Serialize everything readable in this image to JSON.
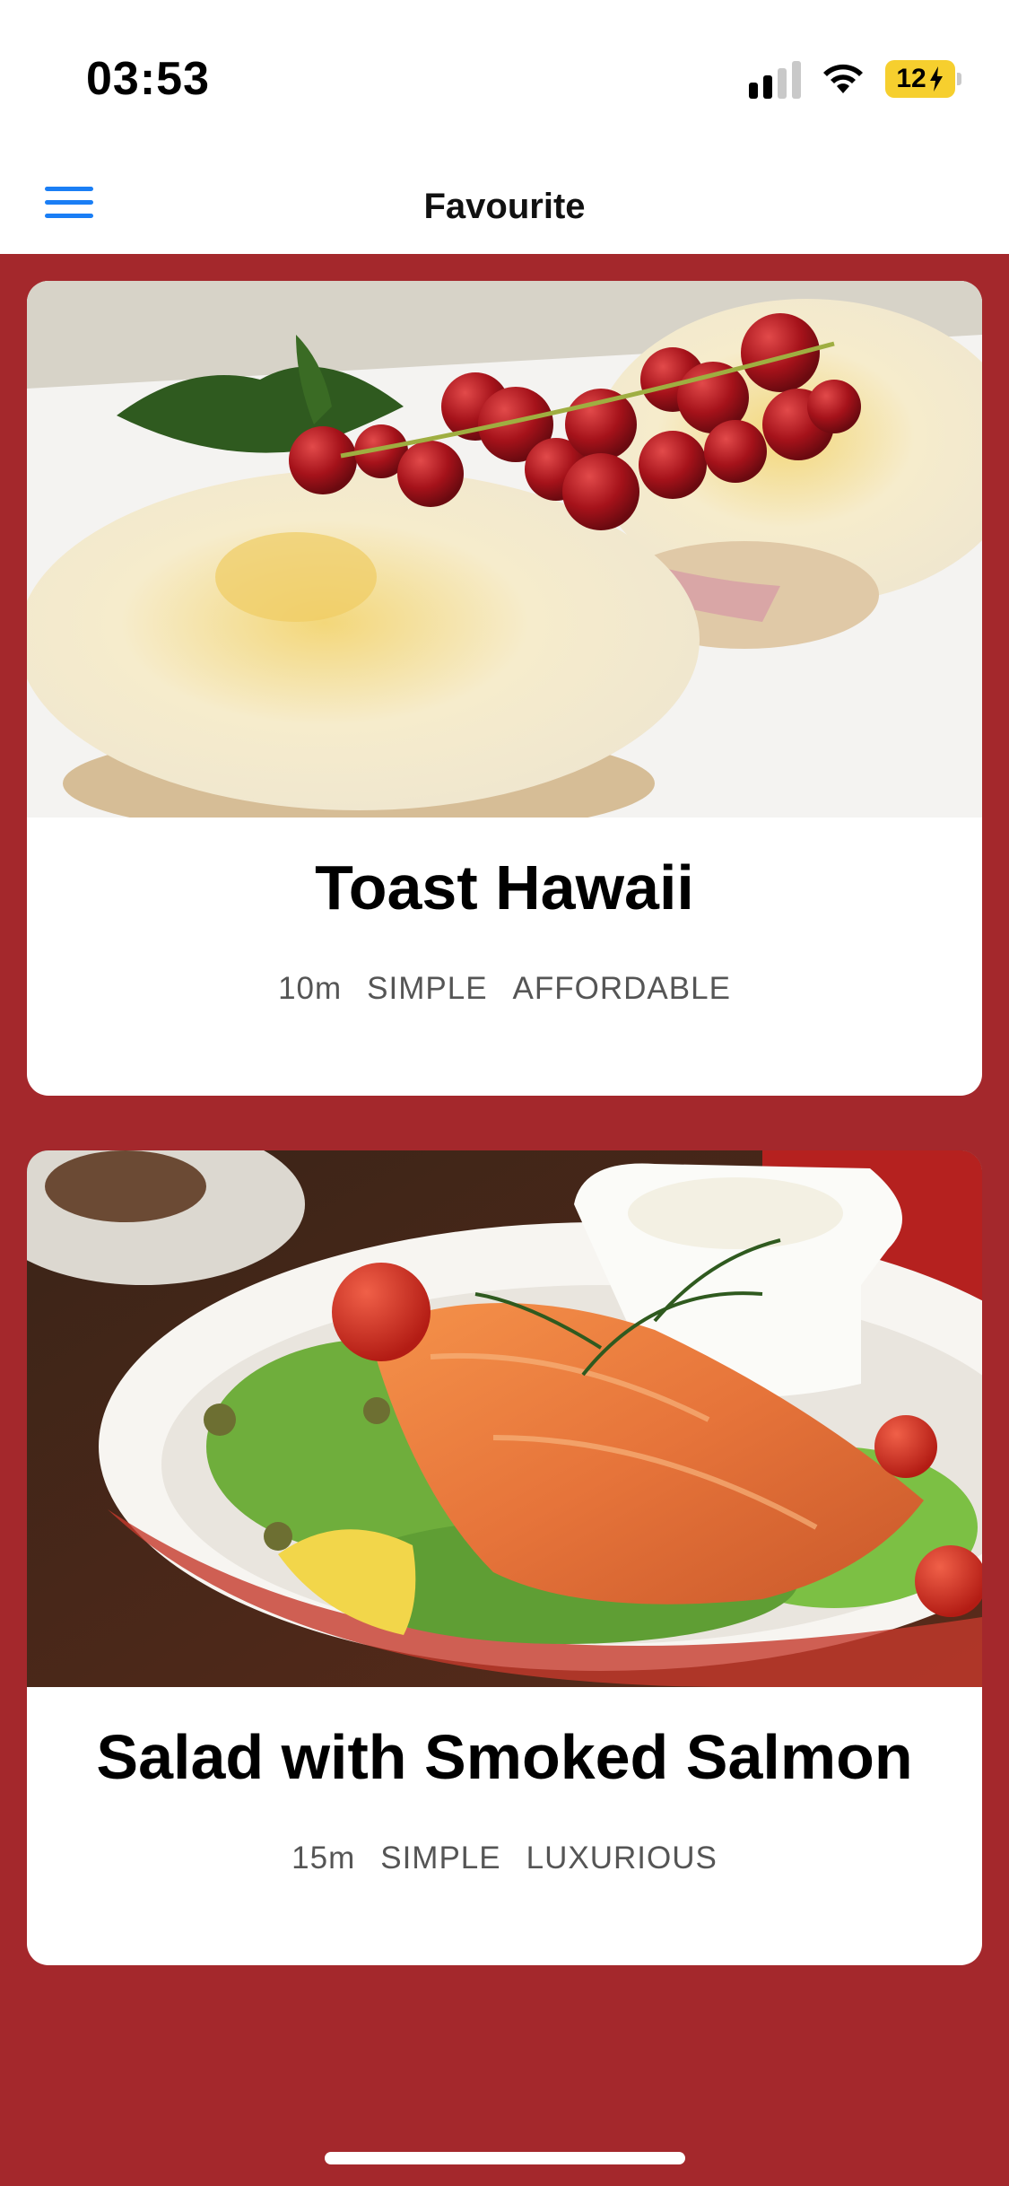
{
  "status_bar": {
    "time": "03:53",
    "battery": "12"
  },
  "nav": {
    "title": "Favourite",
    "menu_icon": "hamburger-menu-icon",
    "accent": "#1a7ef5"
  },
  "theme": {
    "background": "#a4282c"
  },
  "meals": [
    {
      "title": "Toast Hawaii",
      "duration": "10m",
      "complexity": "SIMPLE",
      "affordability": "AFFORDABLE"
    },
    {
      "title": "Salad with Smoked Salmon",
      "duration": "15m",
      "complexity": "SIMPLE",
      "affordability": "LUXURIOUS"
    }
  ]
}
